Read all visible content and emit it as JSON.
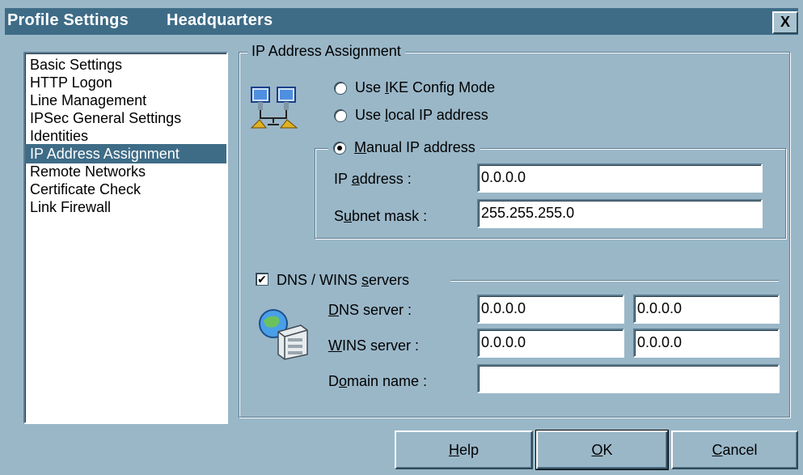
{
  "window": {
    "title": "Profile Settings",
    "profile_name": "Headquarters",
    "close_glyph": "X"
  },
  "nav": {
    "items": [
      {
        "label": "Basic Settings",
        "selected": false
      },
      {
        "label": "HTTP Logon",
        "selected": false
      },
      {
        "label": "Line Management",
        "selected": false
      },
      {
        "label": "IPSec General Settings",
        "selected": false
      },
      {
        "label": "Identities",
        "selected": false
      },
      {
        "label": "IP Address Assignment",
        "selected": true
      },
      {
        "label": "Remote Networks",
        "selected": false
      },
      {
        "label": "Certificate Check",
        "selected": false
      },
      {
        "label": "Link Firewall",
        "selected": false
      }
    ]
  },
  "ip_assignment": {
    "legend": "IP Address Assignment",
    "options": {
      "ike": {
        "pre": "Use ",
        "key": "I",
        "post": "KE Config Mode",
        "checked": false
      },
      "local": {
        "pre": "Use ",
        "key": "l",
        "post": "ocal IP address",
        "checked": false
      },
      "manual": {
        "pre": "",
        "key": "M",
        "post": "anual IP address",
        "checked": true
      }
    },
    "ip_address": {
      "pre": "IP ",
      "key": "a",
      "post": "ddress :",
      "value": "0.0.0.0"
    },
    "subnet_mask": {
      "pre": "S",
      "key": "u",
      "post": "bnet mask :",
      "value": "255.255.255.0"
    }
  },
  "dns_wins": {
    "checkbox": {
      "pre": "DNS / WINS ",
      "key": "s",
      "post": "ervers",
      "checked": true,
      "glyph": "✔"
    },
    "dns_server": {
      "pre": "",
      "key": "D",
      "post": "NS server :",
      "primary": "0.0.0.0",
      "secondary": "0.0.0.0"
    },
    "wins_server": {
      "pre": "",
      "key": "W",
      "post": "INS server :",
      "primary": "0.0.0.0",
      "secondary": "0.0.0.0"
    },
    "domain_name": {
      "pre": "D",
      "key": "o",
      "post": "main name :",
      "value": ""
    }
  },
  "buttons": {
    "help": {
      "key": "H",
      "post": "elp"
    },
    "ok": {
      "key": "O",
      "post": "K"
    },
    "cancel": {
      "key": "C",
      "post": "ancel"
    }
  },
  "colors": {
    "dialog_bg": "#9AB7C8",
    "title_bar": "#3E6C87",
    "selection": "#3E6C87"
  }
}
